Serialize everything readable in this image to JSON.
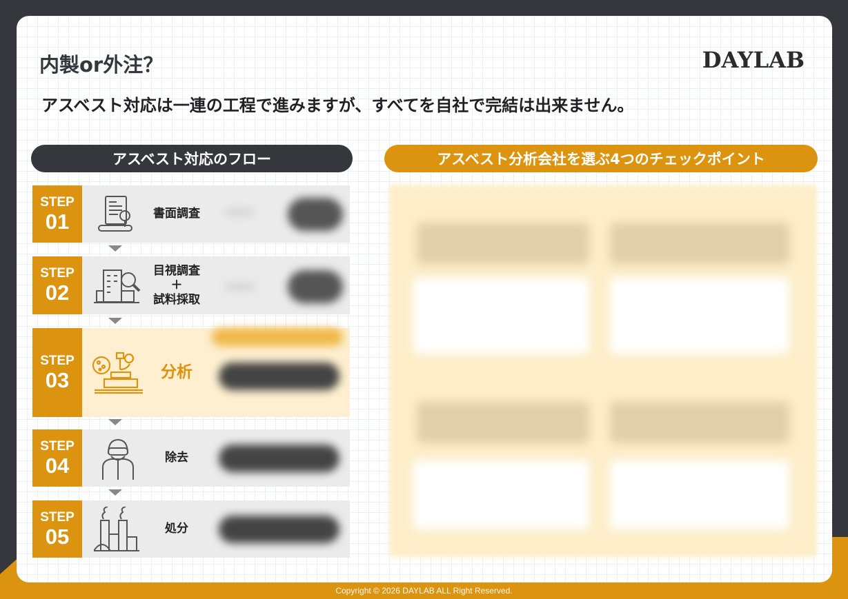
{
  "title": "内製or外注？",
  "logo": "DAYLAB",
  "subtitle": "アスベスト対応は一連の工程で進みますが、すべてを自社で完結は出来ません。",
  "flow_header": "アスベスト対応のフロー",
  "checkpoint_header": "アスベスト分析会社を選ぶ4つのチェックポイント",
  "steps": [
    {
      "step": "STEP",
      "num": "01",
      "label": "書面調査",
      "icon": "document-icon"
    },
    {
      "step": "STEP",
      "num": "02",
      "label": "目視調査\n＋\n試料採取",
      "icon": "building-search-icon"
    },
    {
      "step": "STEP",
      "num": "03",
      "label": "分析",
      "icon": "microscope-icon"
    },
    {
      "step": "STEP",
      "num": "04",
      "label": "除去",
      "icon": "protective-suit-icon"
    },
    {
      "step": "STEP",
      "num": "05",
      "label": "処分",
      "icon": "factory-icon"
    }
  ],
  "footer": "Copyright © 2026 DAYLAB ALL Right Reserved.",
  "colors": {
    "accent": "#dc9410",
    "dark": "#36363d",
    "highlight": "#fdefcf"
  }
}
